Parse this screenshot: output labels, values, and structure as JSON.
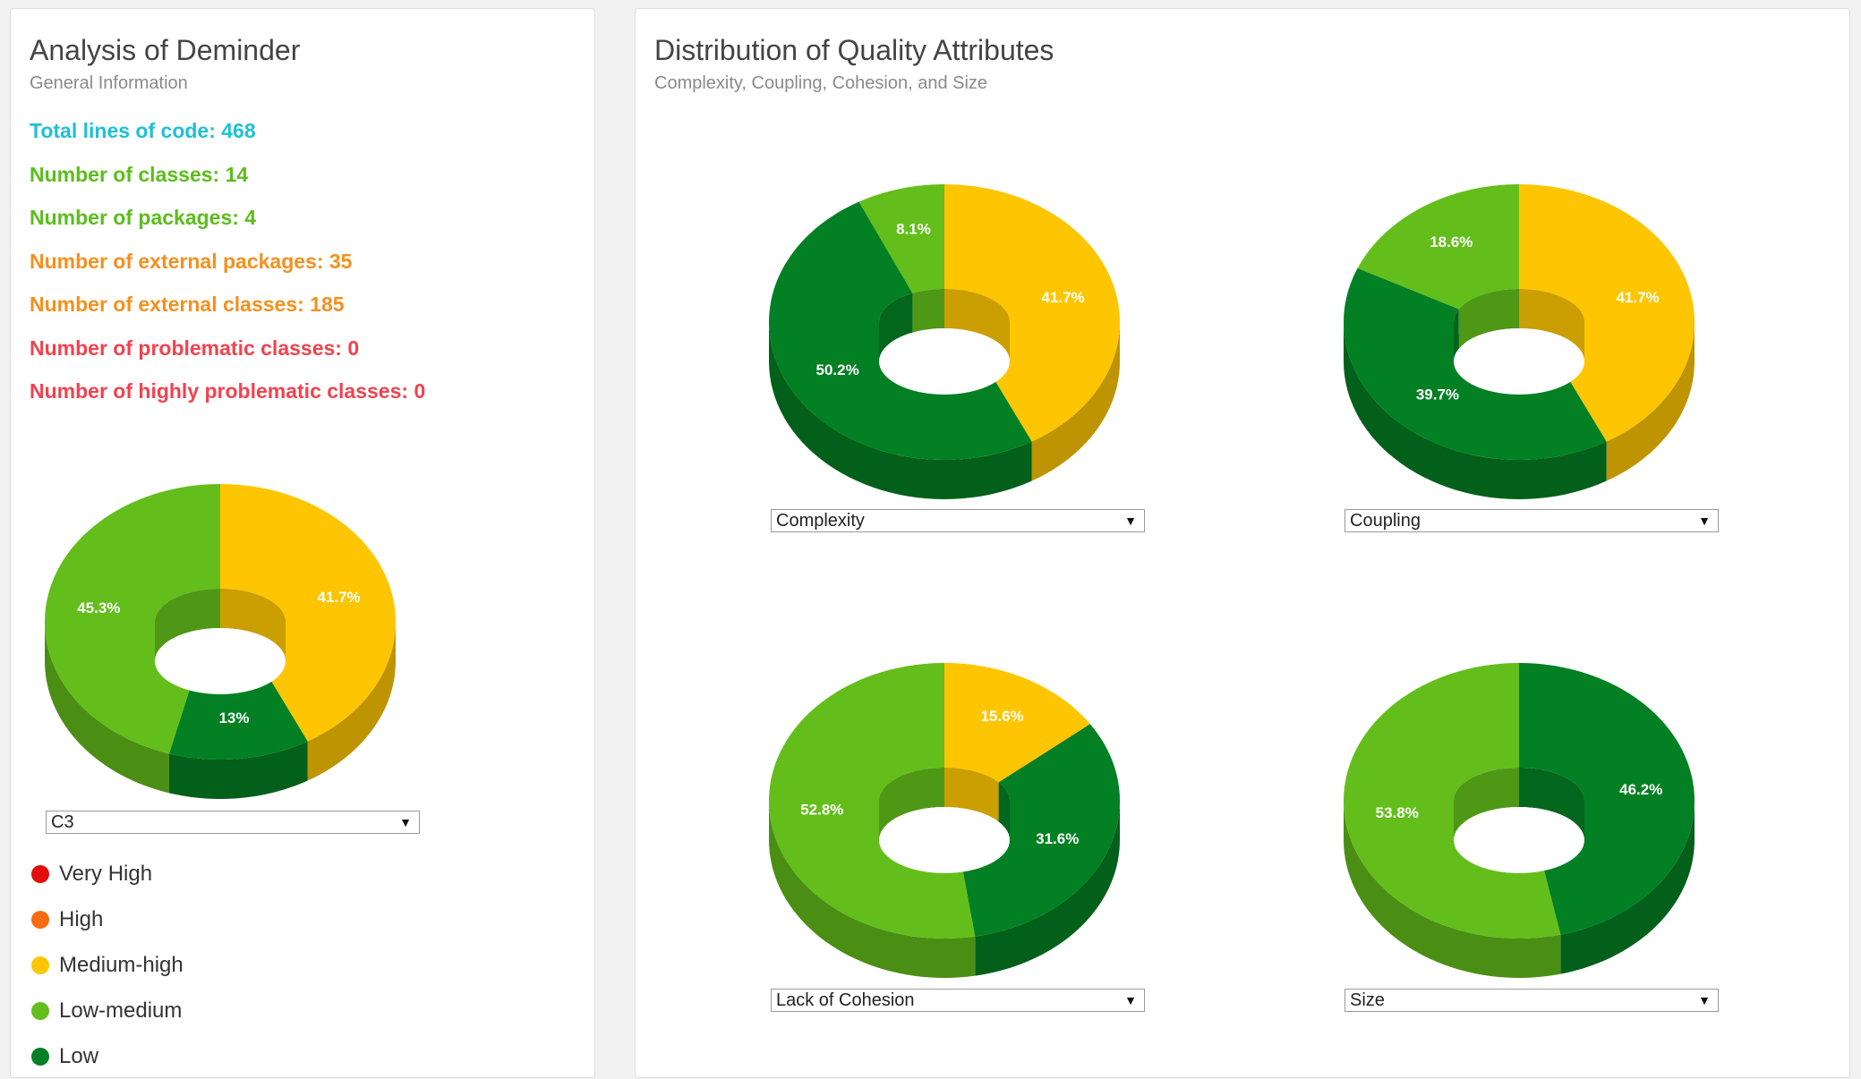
{
  "left": {
    "title": "Analysis of Deminder",
    "subtitle": "General Information",
    "stats": [
      {
        "label": "Total lines of code: 468",
        "color": "#1fbfd8"
      },
      {
        "label": "Number of classes: 14",
        "color": "#5cbd1c"
      },
      {
        "label": "Number of packages: 4",
        "color": "#5cbd1c"
      },
      {
        "label": "Number of external packages: 35",
        "color": "#f5901e"
      },
      {
        "label": "Number of external classes: 185",
        "color": "#f5901e"
      },
      {
        "label": "Number of problematic classes: 0",
        "color": "#f2424e"
      },
      {
        "label": "Number of highly problematic classes: 0",
        "color": "#f2424e"
      }
    ],
    "chart_select": "C3",
    "legend": [
      {
        "label": "Very High",
        "color": "#e30c0c"
      },
      {
        "label": "High",
        "color": "#f76b13"
      },
      {
        "label": "Medium-high",
        "color": "#fec502"
      },
      {
        "label": "Low-medium",
        "color": "#63be1b"
      },
      {
        "label": "Low",
        "color": "#028023"
      }
    ]
  },
  "right": {
    "title": "Distribution of Quality Attributes",
    "subtitle": "Complexity, Coupling, Cohesion, and Size"
  },
  "chart_data": [
    {
      "type": "pie",
      "select": "C3",
      "slices": [
        {
          "category": "Medium-high",
          "value": 41.7,
          "label": "41.7%",
          "color": "#fec502"
        },
        {
          "category": "Low",
          "value": 13,
          "label": "13%",
          "color": "#028023"
        },
        {
          "category": "Low-medium",
          "value": 45.3,
          "label": "45.3%",
          "color": "#63be1b"
        }
      ]
    },
    {
      "type": "pie",
      "select": "Complexity",
      "slices": [
        {
          "category": "Medium-high",
          "value": 41.7,
          "label": "41.7%",
          "color": "#fec502"
        },
        {
          "category": "Low",
          "value": 50.2,
          "label": "50.2%",
          "color": "#028023"
        },
        {
          "category": "Low-medium",
          "value": 8.1,
          "label": "8.1%",
          "color": "#63be1b"
        }
      ]
    },
    {
      "type": "pie",
      "select": "Coupling",
      "slices": [
        {
          "category": "Medium-high",
          "value": 41.7,
          "label": "41.7%",
          "color": "#fec502"
        },
        {
          "category": "Low",
          "value": 39.7,
          "label": "39.7%",
          "color": "#028023"
        },
        {
          "category": "Low-medium",
          "value": 18.6,
          "label": "18.6%",
          "color": "#63be1b"
        }
      ]
    },
    {
      "type": "pie",
      "select": "Lack of Cohesion",
      "slices": [
        {
          "category": "Medium-high",
          "value": 15.6,
          "label": "15.6%",
          "color": "#fec502"
        },
        {
          "category": "Low",
          "value": 31.6,
          "label": "31.6%",
          "color": "#028023"
        },
        {
          "category": "Low-medium",
          "value": 52.8,
          "label": "52.8%",
          "color": "#63be1b"
        }
      ]
    },
    {
      "type": "pie",
      "select": "Size",
      "slices": [
        {
          "category": "Low",
          "value": 46.2,
          "label": "46.2%",
          "color": "#028023"
        },
        {
          "category": "Low-medium",
          "value": 53.8,
          "label": "53.8%",
          "color": "#63be1b"
        }
      ]
    }
  ]
}
